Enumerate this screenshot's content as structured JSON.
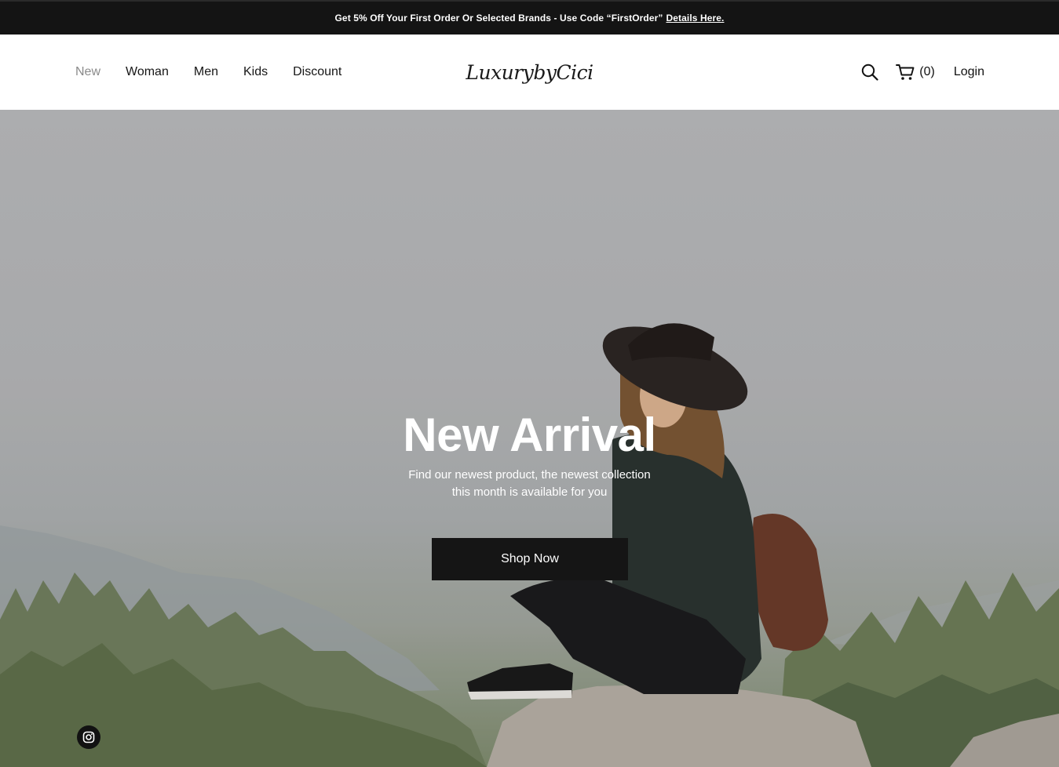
{
  "promo": {
    "text": "Get 5% Off Your First Order Or Selected Brands - Use Code “FirstOrder”",
    "link_label": "Details Here."
  },
  "nav": {
    "items": [
      {
        "label": "New",
        "active": true
      },
      {
        "label": "Woman"
      },
      {
        "label": "Men"
      },
      {
        "label": "Kids"
      },
      {
        "label": "Discount"
      }
    ]
  },
  "brand": {
    "logo_text": "LuxurybyCici"
  },
  "header": {
    "search_icon": "search-icon",
    "cart_icon": "cart-icon",
    "cart_count": "(0)",
    "login_label": "Login"
  },
  "hero": {
    "title": "New Arrival",
    "subtitle_line1": "Find our newest product, the newest collection",
    "subtitle_line2": "this month is available for you",
    "cta_label": "Shop Now"
  },
  "social": {
    "instagram_icon": "instagram-icon"
  },
  "colors": {
    "promo_bg": "#141414",
    "nav_active": "#8a8a8a",
    "button_bg": "#151515",
    "hero_text": "#ffffff"
  }
}
